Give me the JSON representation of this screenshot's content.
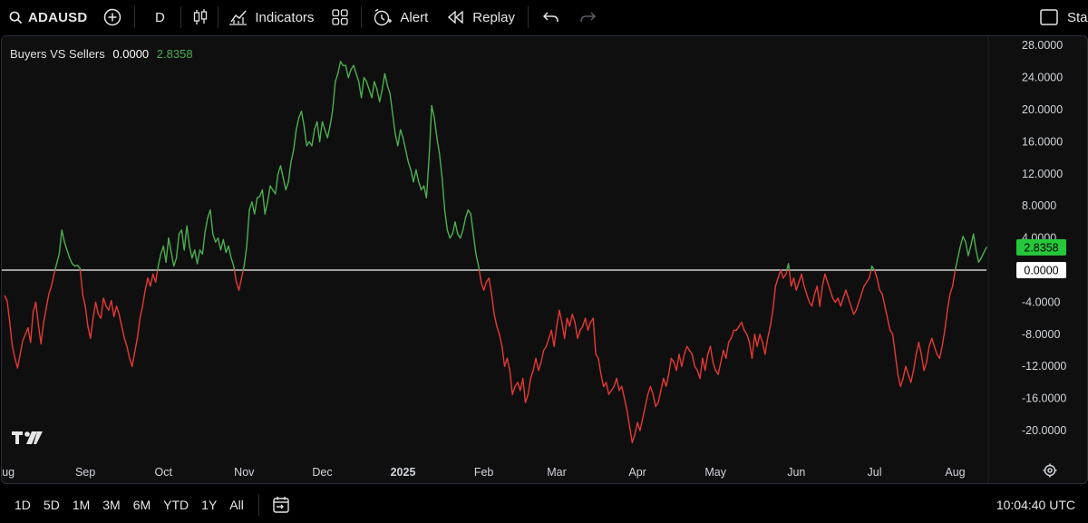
{
  "toolbar": {
    "symbol": "ADAUSD",
    "interval": "D",
    "indicators_label": "Indicators",
    "alert_label": "Alert",
    "replay_label": "Replay",
    "right_label": "Sta"
  },
  "legend": {
    "name": "Buyers VS Sellers",
    "value_white": "0.0000",
    "value_green": "2.8358"
  },
  "price_labels": {
    "current": "2.8358",
    "zero": "0.0000"
  },
  "colors": {
    "positive": "#4caf50",
    "negative": "#e53935",
    "zero_line": "#cfcfcf",
    "current_badge": "#26c83a"
  },
  "bottombar": {
    "ranges": [
      "1D",
      "5D",
      "1M",
      "3M",
      "6M",
      "YTD",
      "1Y",
      "All"
    ],
    "clock": "10:04:40 UTC"
  },
  "chart_data": {
    "type": "line",
    "y_ticks": [
      "28.0000",
      "24.0000",
      "20.0000",
      "16.0000",
      "12.0000",
      "8.0000",
      "4.0000",
      "0.0000",
      "-4.0000",
      "-8.0000",
      "-12.0000",
      "-16.0000",
      "-20.0000"
    ],
    "y_tick_values": [
      28,
      24,
      20,
      16,
      12,
      8,
      4,
      0,
      -4,
      -8,
      -12,
      -16,
      -20
    ],
    "x_ticks": [
      "Aug",
      "Sep",
      "Oct",
      "Nov",
      "Dec",
      "2025",
      "Feb",
      "Mar",
      "Apr",
      "May",
      "Jun",
      "Jul",
      "Aug"
    ],
    "x_tick_bold": [
      false,
      false,
      false,
      false,
      false,
      true,
      false,
      false,
      false,
      false,
      false,
      false,
      false
    ],
    "x_tick_index": [
      0,
      31,
      61,
      92,
      122,
      153,
      184,
      212,
      243,
      273,
      304,
      334,
      365
    ],
    "ylim": [
      -24,
      30
    ],
    "series": [
      {
        "values": [
          -3.2,
          -3.8,
          -6.5,
          -9.5,
          -11.0,
          -12.2,
          -10.5,
          -8.8,
          -8.0,
          -7.2,
          -9.0,
          -5.2,
          -4.0,
          -6.8,
          -9.2,
          -6.5,
          -4.8,
          -3.0,
          -2.0,
          -0.5,
          0.8,
          2.0,
          5.0,
          3.5,
          2.5,
          1.5,
          0.8,
          0.5,
          0.6,
          0.2,
          -3.0,
          -4.5,
          -7.0,
          -8.5,
          -6.0,
          -4.0,
          -5.5,
          -6.0,
          -3.5,
          -4.5,
          -5.0,
          -3.8,
          -5.8,
          -4.5,
          -5.5,
          -7.0,
          -8.5,
          -9.5,
          -11.0,
          -12.0,
          -10.2,
          -8.5,
          -6.0,
          -4.5,
          -2.5,
          -1.0,
          -2.0,
          -0.5,
          -1.5,
          0.5,
          2.0,
          3.0,
          1.0,
          4.0,
          2.2,
          0.5,
          1.5,
          4.5,
          5.0,
          2.5,
          5.5,
          3.0,
          1.5,
          2.5,
          0.8,
          2.5,
          2.0,
          4.8,
          6.5,
          7.5,
          4.5,
          3.5,
          4.0,
          2.5,
          3.8,
          2.2,
          3.0,
          1.5,
          0.5,
          -1.5,
          -2.5,
          -1.0,
          0.5,
          3.0,
          7.5,
          8.5,
          7.0,
          9.0,
          9.2,
          10.0,
          7.0,
          8.5,
          10.5,
          10.0,
          9.5,
          12.0,
          13.0,
          11.5,
          10.0,
          11.0,
          13.5,
          15.0,
          17.5,
          19.0,
          19.8,
          18.0,
          15.5,
          16.0,
          15.5,
          17.5,
          18.5,
          16.0,
          18.5,
          17.5,
          16.5,
          18.0,
          20.0,
          23.5,
          24.5,
          26.0,
          25.5,
          25.5,
          24.0,
          25.0,
          25.5,
          24.5,
          23.5,
          21.5,
          24.0,
          23.5,
          22.5,
          21.5,
          23.5,
          22.5,
          21.0,
          22.5,
          24.5,
          23.0,
          22.0,
          19.5,
          17.0,
          15.5,
          17.5,
          16.5,
          15.0,
          13.5,
          12.5,
          11.0,
          12.5,
          11.0,
          10.0,
          10.5,
          9.0,
          14.0,
          20.5,
          19.0,
          16.5,
          14.5,
          11.5,
          7.5,
          5.0,
          4.0,
          4.5,
          6.0,
          4.5,
          4.0,
          5.0,
          6.5,
          7.5,
          7.0,
          4.5,
          2.0,
          0.5,
          -1.5,
          -2.5,
          -1.5,
          -1.0,
          -3.0,
          -5.5,
          -7.0,
          -8.0,
          -9.5,
          -12.0,
          -11.0,
          -12.5,
          -15.5,
          -14.5,
          -14.0,
          -15.0,
          -13.5,
          -16.5,
          -15.5,
          -13.5,
          -12.5,
          -11.0,
          -12.5,
          -11.5,
          -10.0,
          -9.5,
          -8.5,
          -7.5,
          -9.5,
          -7.0,
          -5.0,
          -6.5,
          -8.5,
          -6.0,
          -7.0,
          -5.5,
          -6.5,
          -8.5,
          -7.5,
          -7.0,
          -6.0,
          -7.5,
          -6.5,
          -6.0,
          -10.5,
          -11.0,
          -13.0,
          -14.5,
          -14.0,
          -15.5,
          -15.0,
          -14.5,
          -13.5,
          -15.0,
          -14.5,
          -16.0,
          -17.5,
          -19.5,
          -21.5,
          -20.5,
          -19.0,
          -20.0,
          -18.5,
          -17.0,
          -15.5,
          -14.5,
          -15.5,
          -17.0,
          -16.5,
          -15.0,
          -13.5,
          -14.5,
          -13.0,
          -11.0,
          -11.5,
          -12.5,
          -10.5,
          -12.0,
          -10.5,
          -9.5,
          -10.0,
          -10.5,
          -12.0,
          -12.5,
          -13.5,
          -11.0,
          -12.5,
          -10.5,
          -9.5,
          -11.5,
          -12.5,
          -13.0,
          -11.5,
          -10.0,
          -11.0,
          -9.0,
          -8.5,
          -7.5,
          -7.5,
          -7.0,
          -6.5,
          -7.5,
          -8.0,
          -9.0,
          -11.0,
          -8.0,
          -9.5,
          -8.0,
          -9.0,
          -10.5,
          -8.5,
          -7.0,
          -5.0,
          -2.0,
          -1.0,
          0.0,
          -1.0,
          -0.5,
          0.8,
          -2.0,
          -1.0,
          -2.5,
          -1.5,
          -0.5,
          -2.0,
          -3.0,
          -4.0,
          -4.5,
          -3.0,
          -2.0,
          -4.5,
          -2.0,
          -0.5,
          -1.5,
          -2.5,
          -3.5,
          -4.0,
          -3.5,
          -4.5,
          -3.5,
          -2.5,
          -3.5,
          -4.5,
          -5.5,
          -5.0,
          -4.0,
          -3.0,
          -2.0,
          -1.5,
          -1.0,
          0.5,
          0.0,
          -1.0,
          -2.5,
          -3.0,
          -4.5,
          -6.0,
          -7.5,
          -8.0,
          -10.5,
          -13.0,
          -14.5,
          -13.5,
          -12.0,
          -13.0,
          -14.0,
          -12.5,
          -10.5,
          -9.0,
          -10.5,
          -12.5,
          -11.5,
          -9.5,
          -8.5,
          -9.5,
          -10.5,
          -11.0,
          -9.5,
          -7.5,
          -5.0,
          -3.0,
          -2.0,
          0.0,
          1.5,
          3.0,
          4.2,
          3.5,
          1.8,
          3.0,
          4.5,
          2.5,
          1.0,
          1.5,
          2.2,
          2.8358
        ]
      }
    ]
  }
}
